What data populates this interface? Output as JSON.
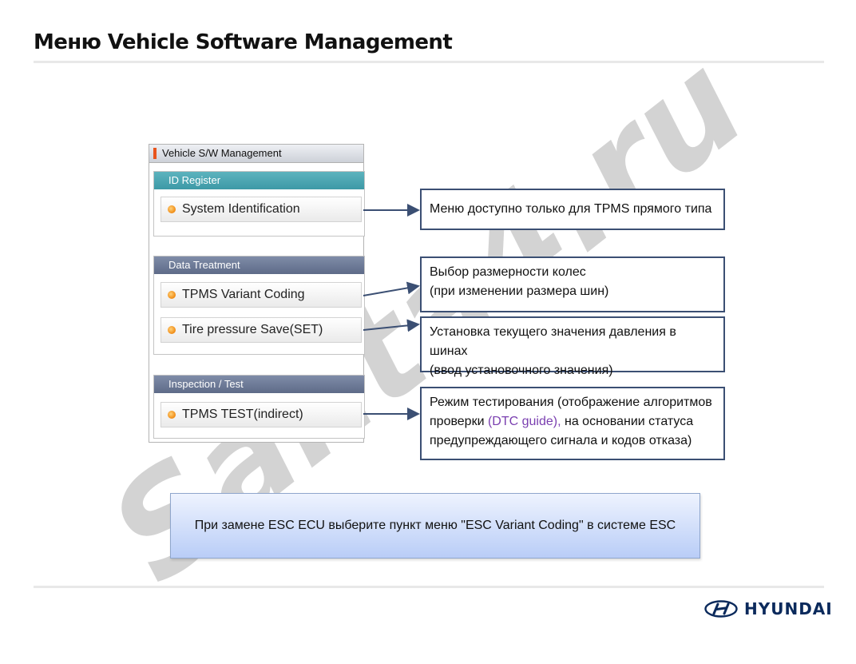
{
  "title": "Меню Vehicle Software Management",
  "watermark": "Santa4.ru",
  "panel": {
    "header": "Vehicle S/W Management",
    "groups": [
      {
        "title": "ID Register",
        "items": [
          "System Identification"
        ]
      },
      {
        "title": "Data Treatment",
        "items": [
          "TPMS Variant Coding",
          "Tire pressure Save(SET)"
        ]
      },
      {
        "title": "Inspection / Test",
        "items": [
          "TPMS TEST(indirect)"
        ]
      }
    ]
  },
  "callouts": [
    {
      "lines": [
        "Меню доступно только для TPMS прямого типа"
      ]
    },
    {
      "lines": [
        "Выбор размерности колес",
        "(при изменении размера шин)"
      ]
    },
    {
      "lines": [
        "Установка текущего значения давления в шинах",
        "(ввод установочного значения)"
      ]
    },
    {
      "line1": "Режим тестирования (отображение алгоритмов",
      "line2_pre": "проверки ",
      "line2_accent": "(DTC guide),",
      "line2_post": " на основании статуса",
      "line3": "предупреждающего сигнала и кодов отказа)"
    }
  ],
  "note": "При замене ESC ECU выберите пункт меню \"ESC Variant Coding\" в системе ESC",
  "logo": {
    "brand": "HYUNDAI"
  },
  "colors": {
    "callout_border": "#3b4f73",
    "accent_text": "#7a3fb0",
    "teal_header": "#3d99a6",
    "blue_header": "#5e6b88",
    "marker": "#e8541c",
    "brand": "#0b2a5c"
  }
}
